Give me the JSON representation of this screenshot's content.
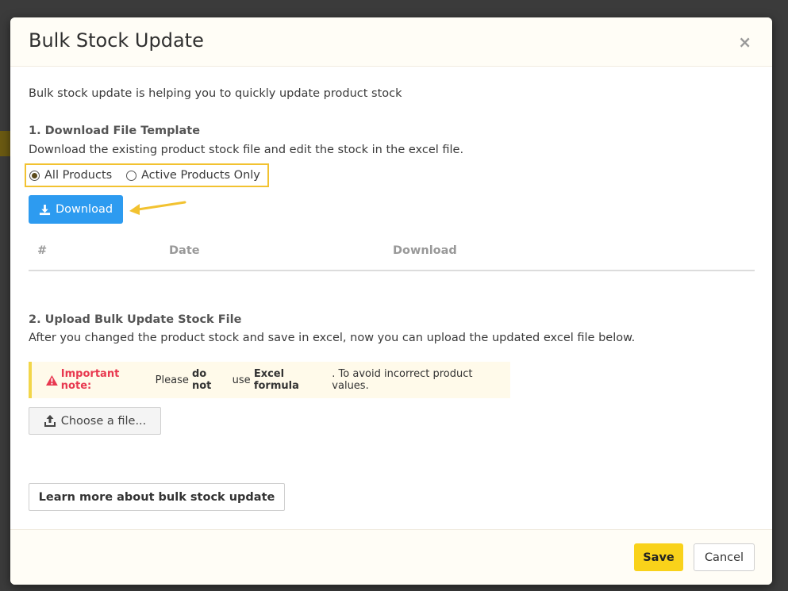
{
  "modal": {
    "title": "Bulk Stock Update",
    "close_label": "×",
    "intro": "Bulk stock update is helping you to quickly update product stock"
  },
  "step1": {
    "title": "1. Download File Template",
    "description": "Download the existing product stock file and edit the stock in the excel file.",
    "radio_options": [
      {
        "label": "All Products",
        "checked": true
      },
      {
        "label": "Active Products Only",
        "checked": false
      }
    ],
    "download_button": "Download",
    "table_headers": [
      "#",
      "Date",
      "Download"
    ]
  },
  "step2": {
    "title": "2. Upload Bulk Update Stock File",
    "description": "After you changed the product stock and save in excel, now you can upload the updated excel file below.",
    "note": {
      "label": "Important note:",
      "text_1": "Please",
      "bold_1": "do not",
      "text_2": "use",
      "bold_2": "Excel formula",
      "text_3": ". To avoid incorrect product values."
    },
    "choose_file_button": "Choose a file..."
  },
  "learn_more_button": "Learn more about bulk stock update",
  "footer": {
    "save_button": "Save",
    "cancel_button": "Cancel"
  },
  "colors": {
    "primary_blue": "#2d9bf0",
    "save_yellow": "#f9d21a",
    "highlight_yellow": "#f2c230",
    "warning_red": "#e8384f"
  },
  "icons": {
    "download_button": "download-icon",
    "choose_file": "upload-icon",
    "note": "warning-icon",
    "annotation": "arrow-annotation"
  }
}
